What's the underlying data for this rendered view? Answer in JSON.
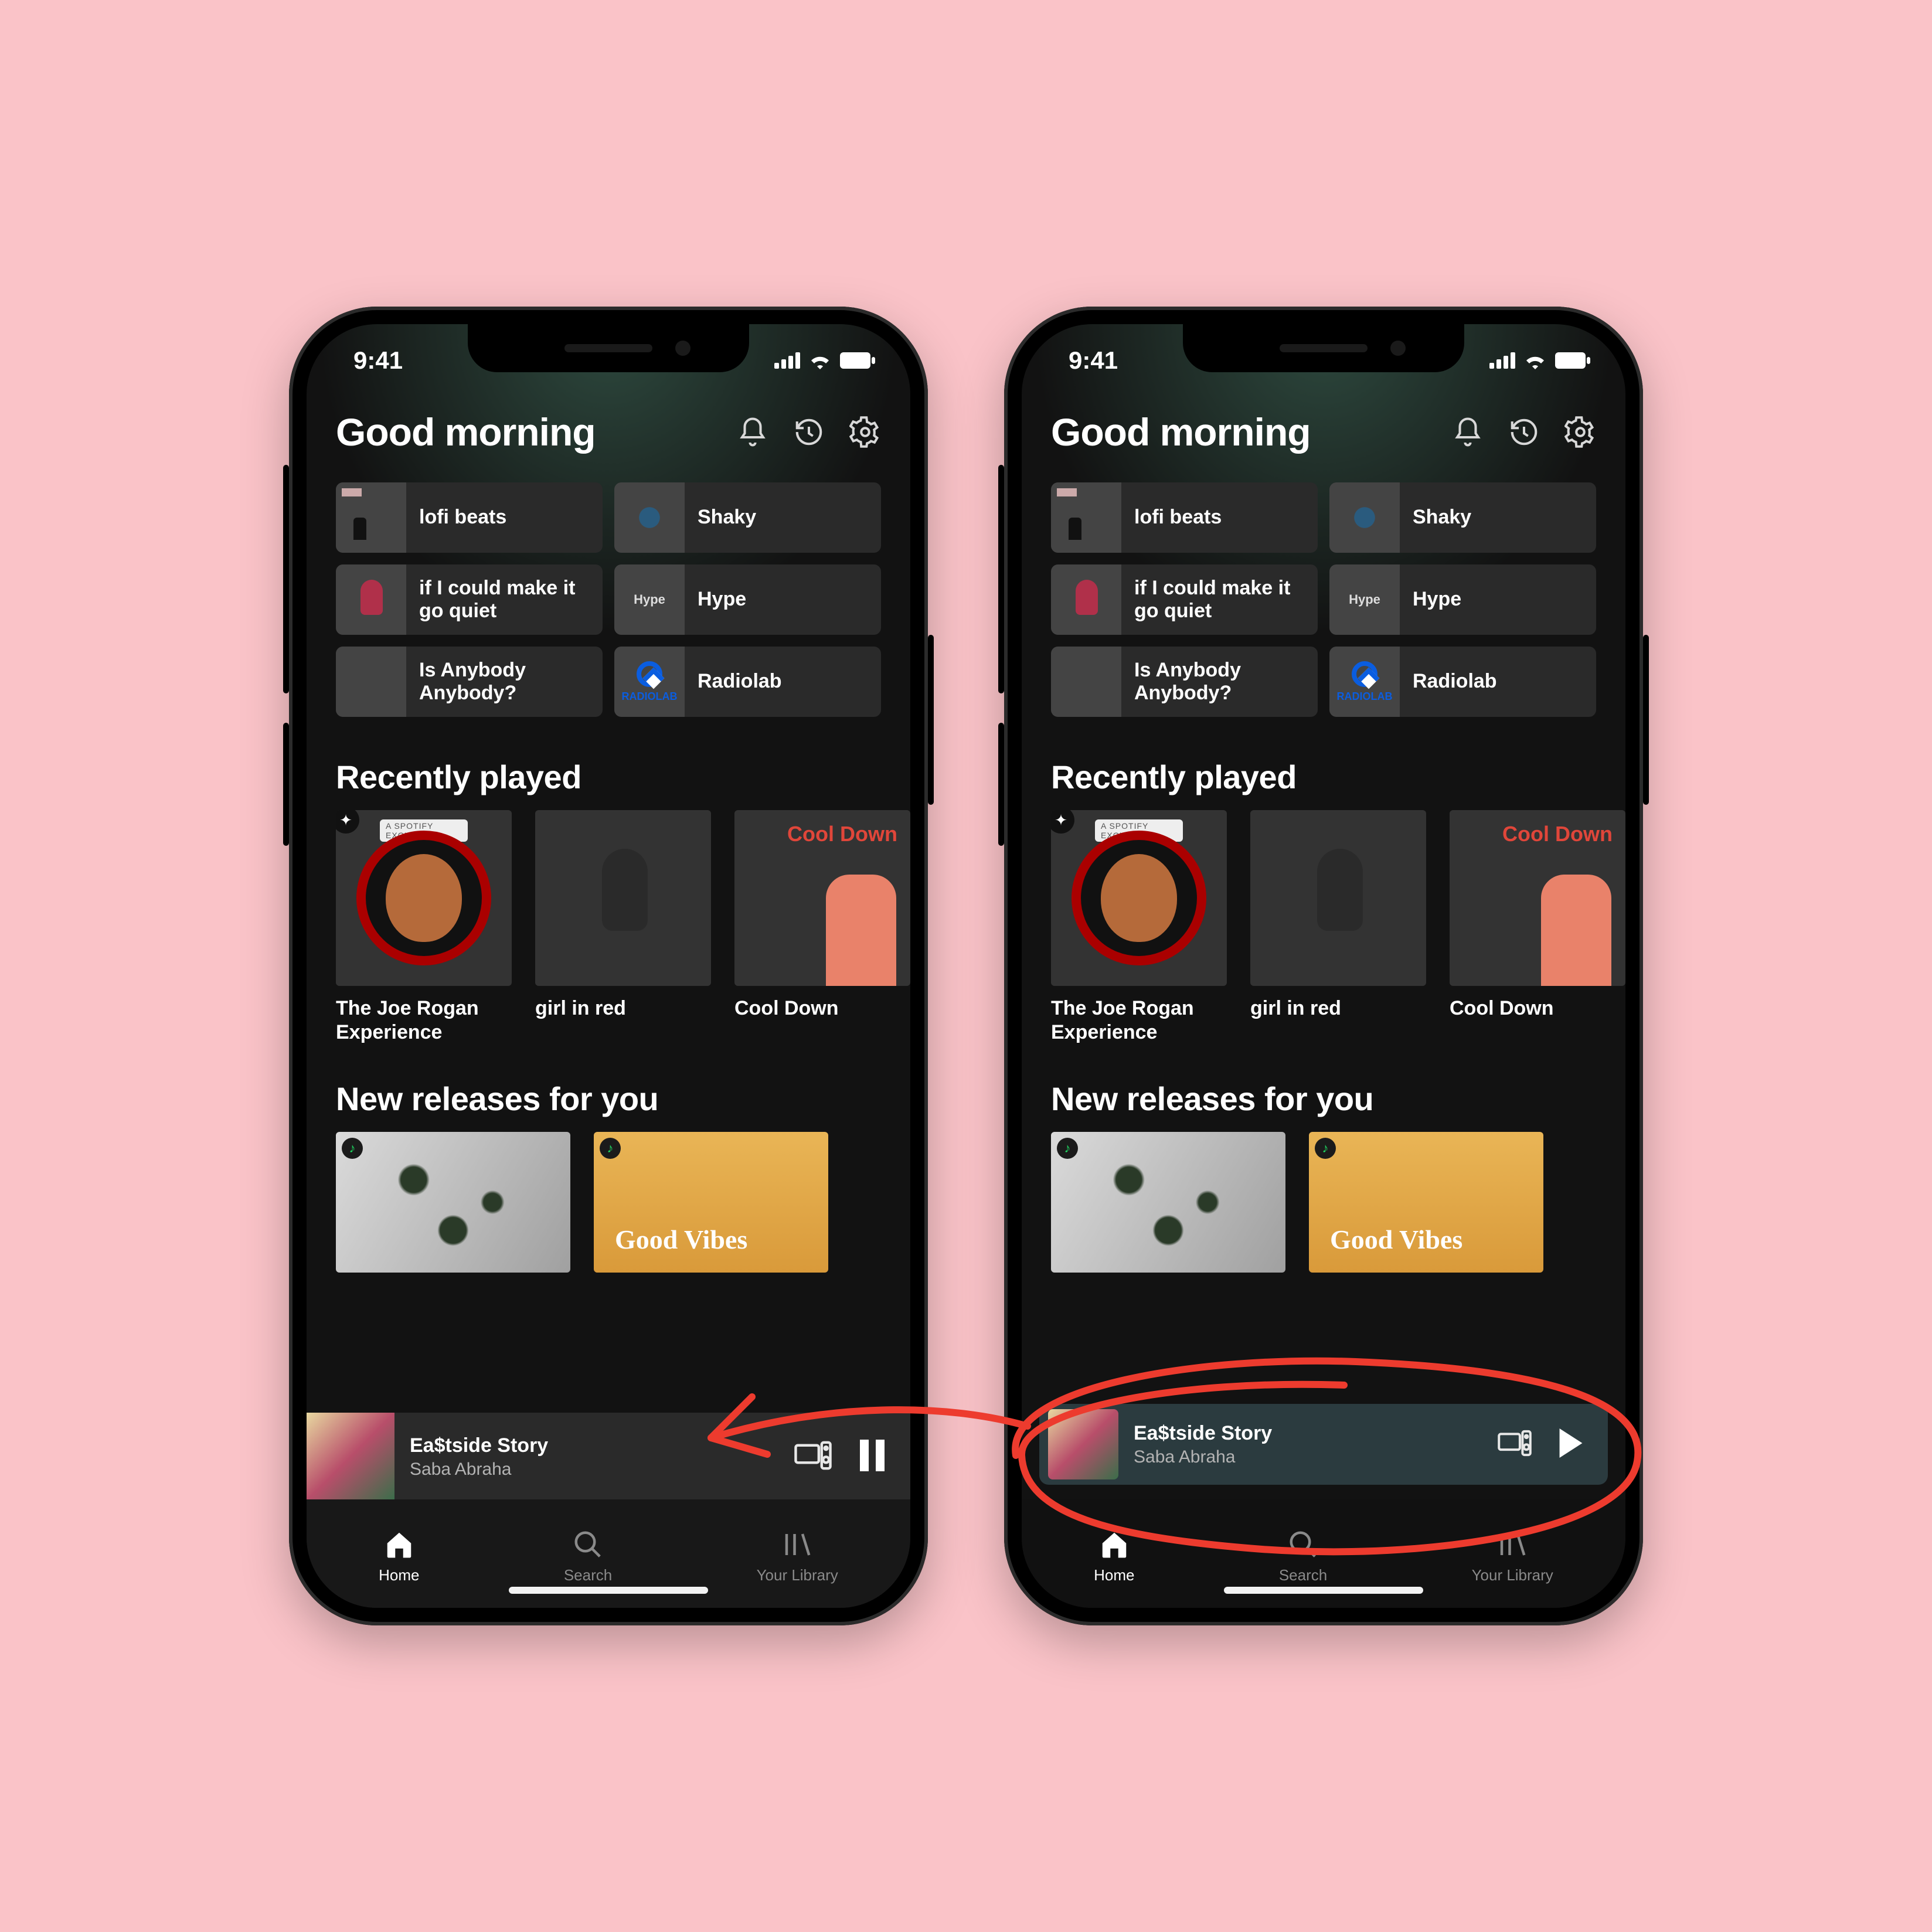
{
  "status": {
    "time": "9:41"
  },
  "header": {
    "greeting": "Good morning"
  },
  "shortcuts": [
    {
      "label": "lofi beats"
    },
    {
      "label": "Shaky"
    },
    {
      "label": "if I could make it go quiet"
    },
    {
      "label": "Hype"
    },
    {
      "label": "Is Anybody Anybody?"
    },
    {
      "label": "Radiolab"
    }
  ],
  "sections": {
    "recent_title": "Recently played",
    "recent": [
      {
        "title": "The Joe Rogan Experience"
      },
      {
        "title": "girl in red"
      },
      {
        "title": "Cool Down"
      }
    ],
    "new_title": "New releases for you",
    "new": [
      {
        "title": ""
      },
      {
        "title": "Good Vibes"
      }
    ]
  },
  "nowplaying": {
    "track": "Ea$tside Story",
    "artist": "Saba Abraha"
  },
  "tabs": {
    "home": "Home",
    "search": "Search",
    "library": "Your Library"
  },
  "misc": {
    "cool_label": "Cool Down",
    "rogan_pill": "A SPOTIFY EXCLUSIVE",
    "radiolab": "RADIOLAB",
    "hype_art": "Hype"
  }
}
